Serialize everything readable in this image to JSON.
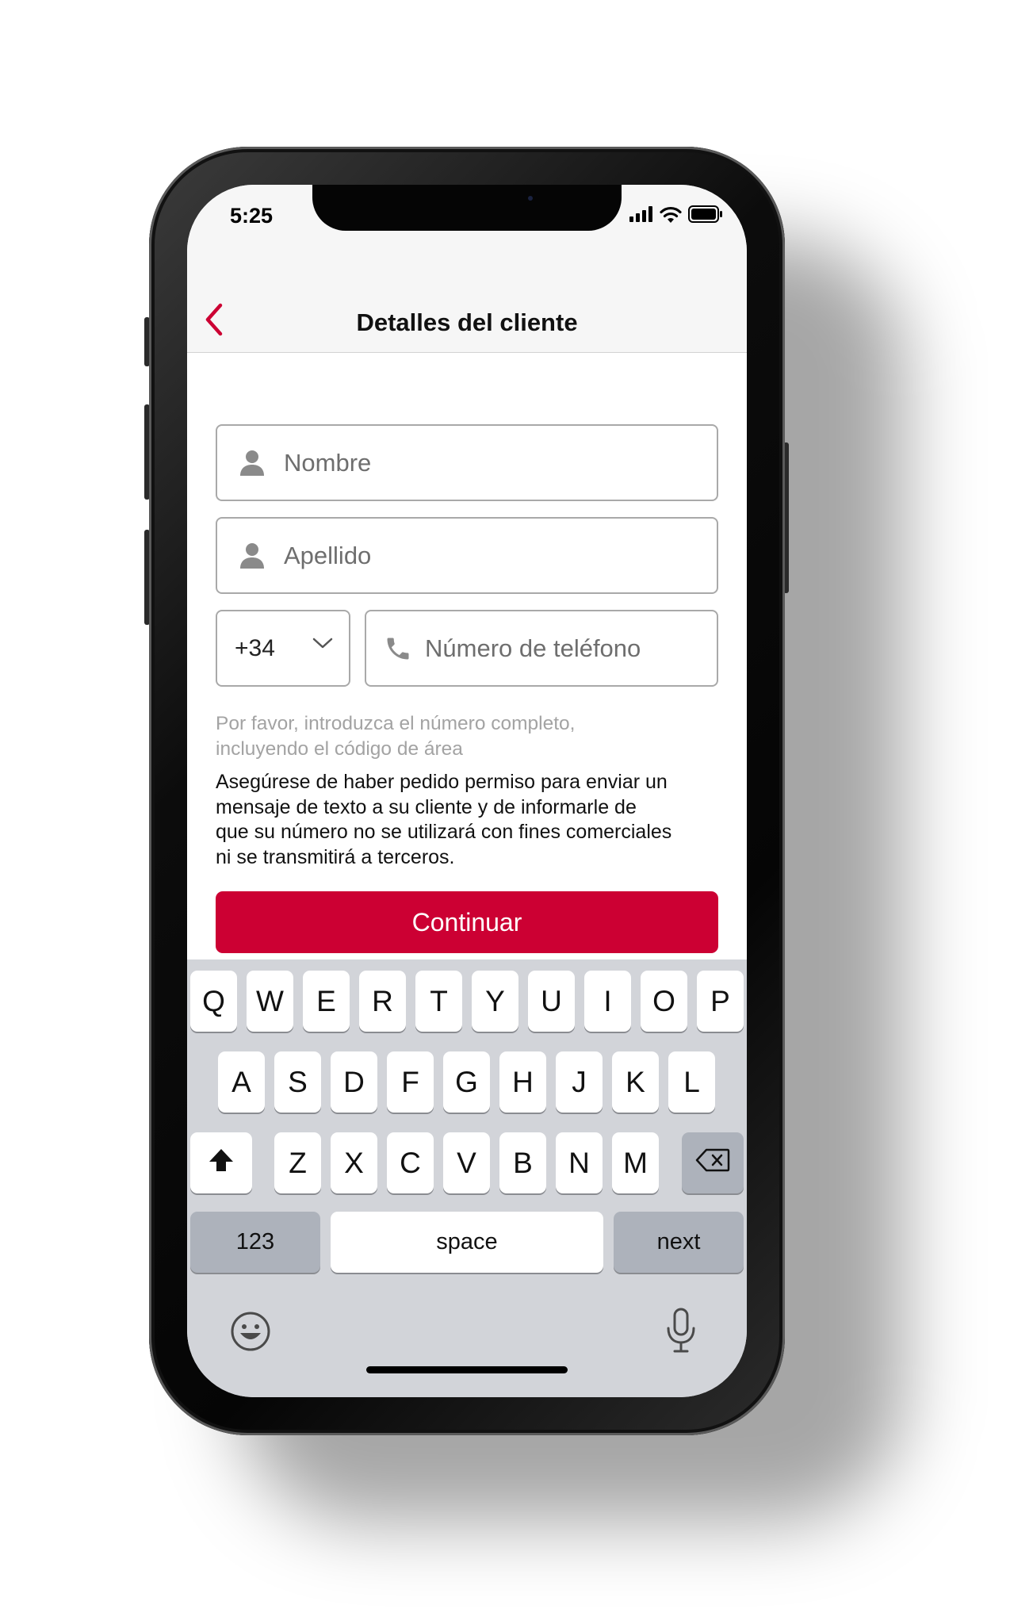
{
  "status_bar": {
    "time": "5:25"
  },
  "nav": {
    "title": "Detalles del cliente",
    "back_icon": "chevron-left-icon"
  },
  "form": {
    "first_name_placeholder": "Nombre",
    "last_name_placeholder": "Apellido",
    "country_code": "+34",
    "phone_placeholder": "Número de teléfono",
    "hint_line1": "Por favor, introduzca el número completo,",
    "hint_line2": "incluyendo el código de área",
    "notice_line1": "Asegúrese de haber pedido permiso para enviar un",
    "notice_line2": "mensaje de texto a su cliente y de informarle de",
    "notice_line3": "que su número no se utilizará con fines comerciales",
    "notice_line4": "ni se transmitirá a terceros.",
    "continue_label": "Continuar"
  },
  "keyboard": {
    "row1": [
      "Q",
      "W",
      "E",
      "R",
      "T",
      "Y",
      "U",
      "I",
      "O",
      "P"
    ],
    "row2": [
      "A",
      "S",
      "D",
      "F",
      "G",
      "H",
      "J",
      "K",
      "L"
    ],
    "row3": [
      "Z",
      "X",
      "C",
      "V",
      "B",
      "N",
      "M"
    ],
    "numbers_label": "123",
    "space_label": "space",
    "next_label": "next"
  },
  "colors": {
    "accent": "#cc0033",
    "nav_background": "#f6f6f6",
    "keyboard_background": "#d2d4d9"
  }
}
